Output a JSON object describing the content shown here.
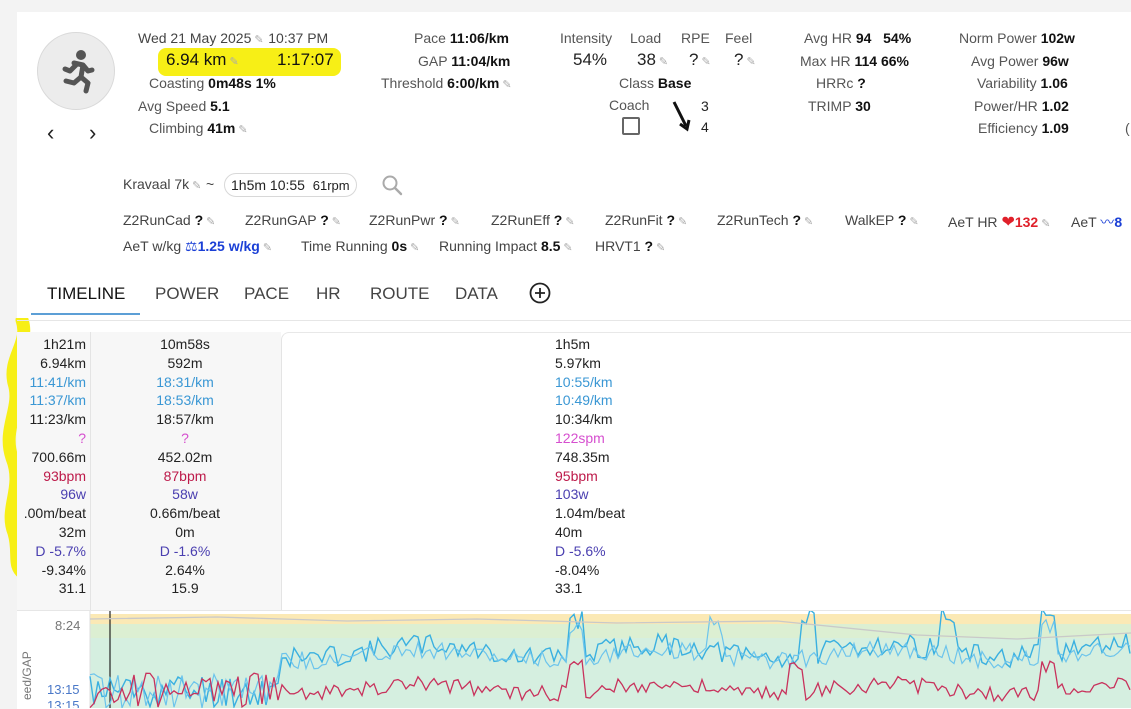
{
  "activity": {
    "date": "Wed 21 May 2025",
    "time": "10:37 PM",
    "distance": "6.94 km",
    "duration": "1:17:07",
    "coasting_label": "Coasting",
    "coasting_value": "0m48s 1%",
    "avg_speed_label": "Avg Speed",
    "avg_speed_value": "5.1",
    "climbing_label": "Climbing",
    "climbing_value": "41m"
  },
  "pace": {
    "pace_label": "Pace",
    "pace_value": "11:06/km",
    "gap_label": "GAP",
    "gap_value": "11:04/km",
    "threshold_label": "Threshold",
    "threshold_value": "6:00/km"
  },
  "load": {
    "intensity_label": "Intensity",
    "intensity_value": "54%",
    "load_label": "Load",
    "load_value": "38",
    "rpe_label": "RPE",
    "rpe_value": "?",
    "feel_label": "Feel",
    "feel_value": "?",
    "class_label": "Class",
    "class_value": "Base",
    "coach_label": "Coach",
    "annot_3": "3",
    "annot_4": "4"
  },
  "hr": {
    "avg_hr_label": "Avg HR",
    "avg_hr_value": "94",
    "avg_hr_pct": "54%",
    "max_hr_label": "Max HR",
    "max_hr_value": "114",
    "max_hr_pct": "66%",
    "hrrc_label": "HRRc",
    "hrrc_value": "?",
    "trimp_label": "TRIMP",
    "trimp_value": "30"
  },
  "power": {
    "norm_label": "Norm Power",
    "norm_value": "102w",
    "avg_label": "Avg Power",
    "avg_value": "96w",
    "var_label": "Variability",
    "var_value": "1.06",
    "phr_label": "Power/HR",
    "phr_value": "1.02",
    "eff_label": "Efficiency",
    "eff_value": "1.09",
    "cut_label": "("
  },
  "gear": {
    "name": "Kravaal 7k",
    "tilde": "~",
    "chip_time": "1h5m 10:55",
    "chip_rpm": "61rpm"
  },
  "fields": {
    "z2runcad": "Z2RunCad",
    "z2runcad_v": "?",
    "z2rungap": "Z2RunGAP",
    "z2rungap_v": "?",
    "z2runpwr": "Z2RunPwr",
    "z2runpwr_v": "?",
    "z2runeff": "Z2RunEff",
    "z2runeff_v": "?",
    "z2runfit": "Z2RunFit",
    "z2runfit_v": "?",
    "z2runtech": "Z2RunTech",
    "z2runtech_v": "?",
    "walkep": "WalkEP",
    "walkep_v": "?",
    "aethr": "AeT HR",
    "aethr_v": "132",
    "aet": "AeT",
    "aet_v": "8",
    "aetwkg": "AeT w/kg",
    "aetwkg_v": "1.25 w/kg",
    "timerun": "Time Running",
    "timerun_v": "0s",
    "runimpact": "Running Impact",
    "runimpact_v": "8.5",
    "hrvt1": "HRVT1",
    "hrvt1_v": "?"
  },
  "tabs": [
    "TIMELINE",
    "POWER",
    "PACE",
    "HR",
    "ROUTE",
    "DATA"
  ],
  "stats": {
    "col1": [
      "1h21m",
      "6.94km",
      "11:41/km",
      "11:37/km",
      "11:23/km",
      "?",
      "700.66m",
      "93bpm",
      "96w",
      ".00m/beat",
      "32m",
      "D -5.7%",
      "-9.34%",
      "31.1"
    ],
    "col2": [
      "10m58s",
      "592m",
      "18:31/km",
      "18:53/km",
      "18:57/km",
      "?",
      "452.02m",
      "87bpm",
      "58w",
      "0.66m/beat",
      "0m",
      "D -1.6%",
      "2.64%",
      "15.9"
    ],
    "col3": [
      "1h5m",
      "5.97km",
      "10:55/km",
      "10:49/km",
      "10:34/km",
      "122spm",
      "748.35m",
      "95bpm",
      "103w",
      "1.04m/beat",
      "40m",
      "D -5.6%",
      "-8.04%",
      "33.1"
    ]
  },
  "chart": {
    "y_tick_top": "8:24",
    "y_tick_bottom_1": "13:15",
    "y_tick_bottom_2": "13:15",
    "y_axis_label": "eed/GAP"
  },
  "colors": {
    "pace_line": "#3ab0e0",
    "hr_line": "#c8325c",
    "zone_green": "#bfe6cf",
    "zone_yellow": "#fbe9b5",
    "highlight": "#f7ef16"
  }
}
